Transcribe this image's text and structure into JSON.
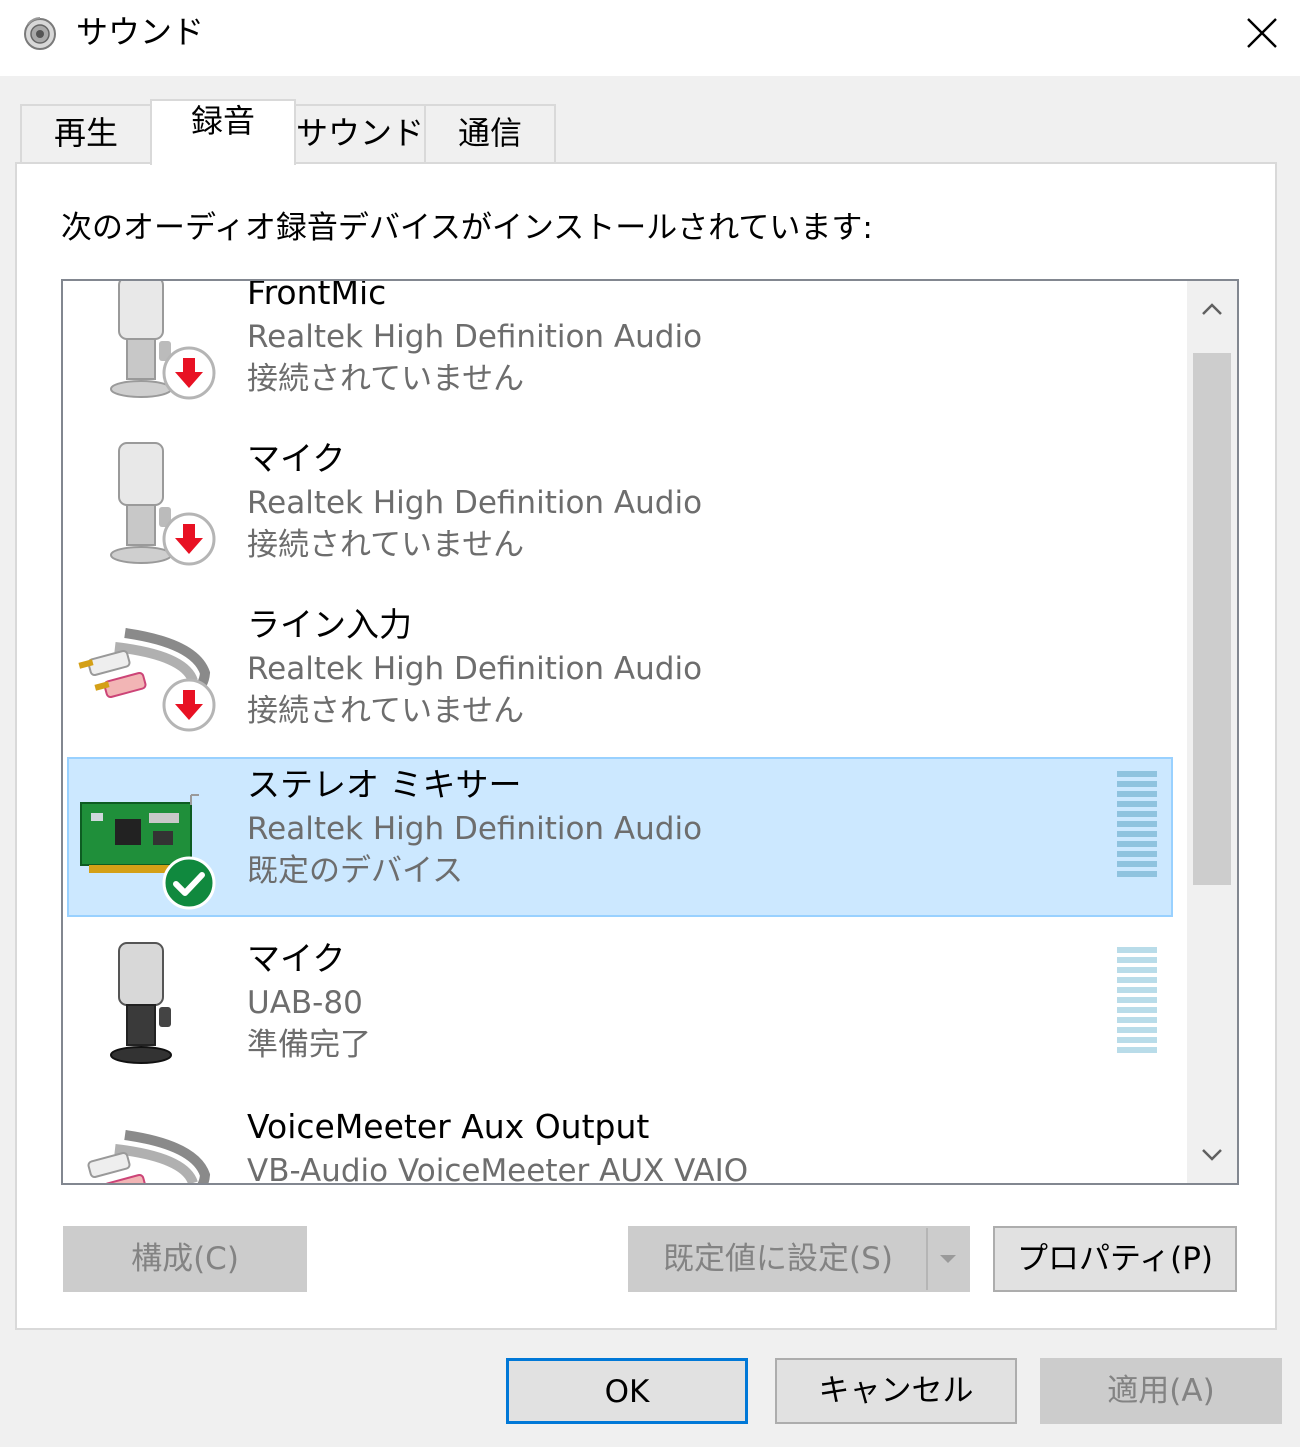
{
  "window": {
    "title": "サウンド"
  },
  "tabs": [
    {
      "label": "再生",
      "active": false
    },
    {
      "label": "録音",
      "active": true
    },
    {
      "label": "サウンド",
      "active": false
    },
    {
      "label": "通信",
      "active": false
    }
  ],
  "instruction": "次のオーディオ録音デバイスがインストールされています:",
  "devices": [
    {
      "name": "FrontMic",
      "description": "Realtek High Definition Audio",
      "status": "接続されていません",
      "icon": "microphone-icon",
      "badge": "disconnected-arrow-icon"
    },
    {
      "name": "マイク",
      "description": "Realtek High Definition Audio",
      "status": "接続されていません",
      "icon": "microphone-icon",
      "badge": "disconnected-arrow-icon"
    },
    {
      "name": "ライン入力",
      "description": "Realtek High Definition Audio",
      "status": "接続されていません",
      "icon": "line-in-cable-icon",
      "badge": "disconnected-arrow-icon"
    },
    {
      "name": "ステレオ ミキサー",
      "description": "Realtek High Definition Audio",
      "status": "既定のデバイス",
      "icon": "sound-card-icon",
      "badge": "default-check-icon",
      "selected": true
    },
    {
      "name": "マイク",
      "description": "UAB-80",
      "status": "準備完了",
      "icon": "microphone-dark-icon"
    },
    {
      "name": "VoiceMeeter Aux Output",
      "description": "VB-Audio VoiceMeeter AUX VAIO",
      "status": "",
      "icon": "line-in-cable-icon"
    }
  ],
  "buttons": {
    "configure": "構成(C)",
    "set_default": "既定値に設定(S)",
    "properties": "プロパティ(P)",
    "ok": "OK",
    "cancel": "キャンセル",
    "apply": "適用(A)"
  },
  "colors": {
    "selection": "#cce8ff",
    "accent": "#0078d7",
    "disconnected": "#e81123",
    "default_check": "#10893e"
  }
}
